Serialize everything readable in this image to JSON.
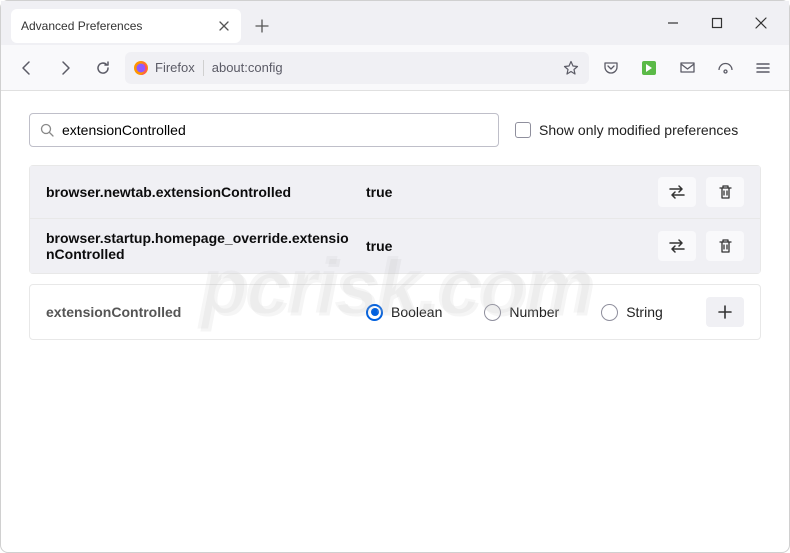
{
  "window": {
    "tab_title": "Advanced Preferences"
  },
  "urlbar": {
    "identity": "Firefox",
    "url": "about:config"
  },
  "search": {
    "value": "extensionControlled",
    "modified_label": "Show only modified preferences"
  },
  "prefs": [
    {
      "name": "browser.newtab.extensionControlled",
      "value": "true"
    },
    {
      "name": "browser.startup.homepage_override.extensionControlled",
      "value": "true"
    }
  ],
  "add": {
    "name": "extensionControlled",
    "radios": {
      "boolean": "Boolean",
      "number": "Number",
      "string": "String"
    }
  },
  "watermark": "pcrisk.com"
}
